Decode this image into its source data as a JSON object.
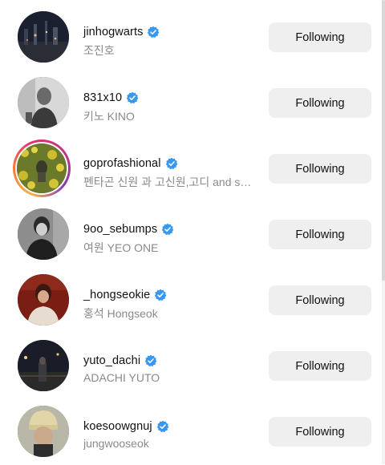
{
  "accounts": [
    {
      "username": "jinhogwarts",
      "subtitle": "조진호",
      "verified": true,
      "button": "Following",
      "has_story": false,
      "avatar_desc": "dark-city-night-icon"
    },
    {
      "username": "831x10",
      "subtitle": "키노 KINO",
      "verified": true,
      "button": "Following",
      "has_story": false,
      "avatar_desc": "bw-portrait-icon"
    },
    {
      "username": "goprofashional",
      "subtitle": "펜타곤 신원 과 고신원,고디 and shi...",
      "verified": true,
      "button": "Following",
      "has_story": true,
      "avatar_desc": "yellow-flowers-photo-icon"
    },
    {
      "username": "9oo_sebumps",
      "subtitle": "여원 YEO ONE",
      "verified": true,
      "button": "Following",
      "has_story": false,
      "avatar_desc": "bw-sweater-portrait-icon"
    },
    {
      "username": "_hongseokie",
      "subtitle": "홍석 Hongseok",
      "verified": true,
      "button": "Following",
      "has_story": false,
      "avatar_desc": "red-background-portrait-icon"
    },
    {
      "username": "yuto_dachi",
      "subtitle": "ADACHI YUTO",
      "verified": true,
      "button": "Following",
      "has_story": false,
      "avatar_desc": "night-street-photo-icon"
    },
    {
      "username": "koesoowgnuj",
      "subtitle": "jungwooseok",
      "verified": true,
      "button": "Following",
      "has_story": false,
      "avatar_desc": "beanie-portrait-icon"
    }
  ],
  "colors": {
    "verified_badge": "#3897f0",
    "button_bg": "#efefef",
    "subtitle": "#8a8a8a"
  }
}
